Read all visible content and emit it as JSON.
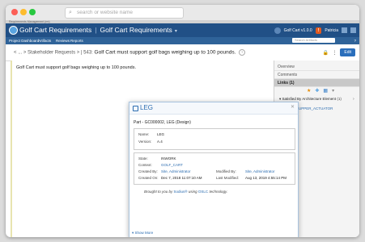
{
  "browser": {
    "url_placeholder": "search or website name",
    "tab_label": "Requirements Management (rm)"
  },
  "app": {
    "title": "Golf Cart Requirements",
    "title2": "Golf Cart Requirements",
    "project_badge": "Golf Cart v1.0.0",
    "user": "Patricia"
  },
  "nav": {
    "items": [
      "Project Dashboard",
      "Artifacts",
      "Reviews",
      "Reports"
    ],
    "search_placeholder": "Search Artifacts",
    "help": "?"
  },
  "breadcrumb": {
    "back": "<",
    "ellipsis": "...",
    "parent": "Stakeholder Requests",
    "id": "543:",
    "title": "Golf Cart must support golf bags weighing up to 100 pounds."
  },
  "toolbar": {
    "edit_label": "Edit"
  },
  "content": {
    "requirement_text": "Golf Cart must support golf bags weighing up to 100 pounds."
  },
  "sidepanel": {
    "overview": "Overview",
    "comments": "Comments",
    "links": "Links (1)",
    "group_label": "Satisfied By Architecture Element",
    "group_count": "(1)",
    "link_item": "UPPER_ACTUATOR",
    "bottom_text": "...ted"
  },
  "popup": {
    "title": "LEG",
    "heading": "Part - GC000002, LEG (Design)",
    "name_label": "Name:",
    "name_value": "LEG",
    "version_label": "Version:",
    "version_value": "A.4",
    "state_label": "State:",
    "state_value": "INWORK",
    "context_label": "Context:",
    "context_value": "GOLF_CART",
    "created_by_label": "Created By:",
    "created_by_value": "Site, Administrator",
    "modified_by_label": "Modified By:",
    "modified_by_value": "Site, Administrator",
    "created_on_label": "Created On:",
    "created_on_value": "Dec 7, 2018 11:07:10 AM",
    "last_modified_label": "Last Modified:",
    "last_modified_value": "Aug 13, 2019 4:55:14 PM",
    "brought_prefix": "Brought to you by",
    "brought_link1": "Sodius®",
    "brought_middle": "using",
    "brought_link2": "OSLC",
    "brought_suffix": "technology.",
    "show_more": "Show More"
  }
}
